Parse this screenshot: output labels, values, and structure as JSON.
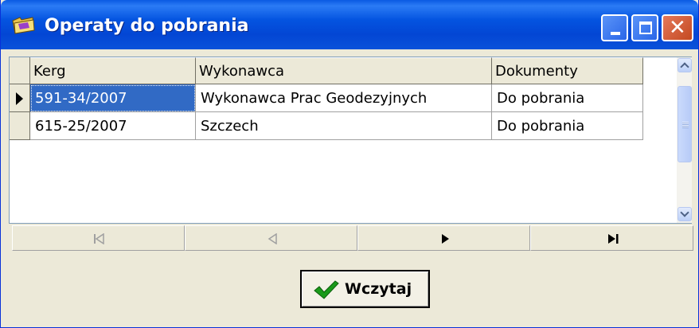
{
  "window": {
    "title": "Operaty do pobrania"
  },
  "grid": {
    "columns": [
      "Kerg",
      "Wykonawca",
      "Dokumenty"
    ],
    "rows": [
      [
        "591-34/2007",
        "Wykonawca Prac Geodezyjnych",
        "Do pobrania"
      ],
      [
        "615-25/2007",
        "Szczech",
        "Do pobrania"
      ]
    ],
    "selected_row": 0
  },
  "navigator": {
    "buttons": [
      "first-icon",
      "prior-icon",
      "next-icon",
      "last-icon"
    ],
    "enabled": [
      false,
      false,
      true,
      true
    ]
  },
  "actions": {
    "load_label": "Wczytaj",
    "load_icon": "checkmark-icon"
  },
  "colors": {
    "title_bar": "#0454e0",
    "selection": "#316ac5",
    "checkmark": "#1a9a1a"
  }
}
